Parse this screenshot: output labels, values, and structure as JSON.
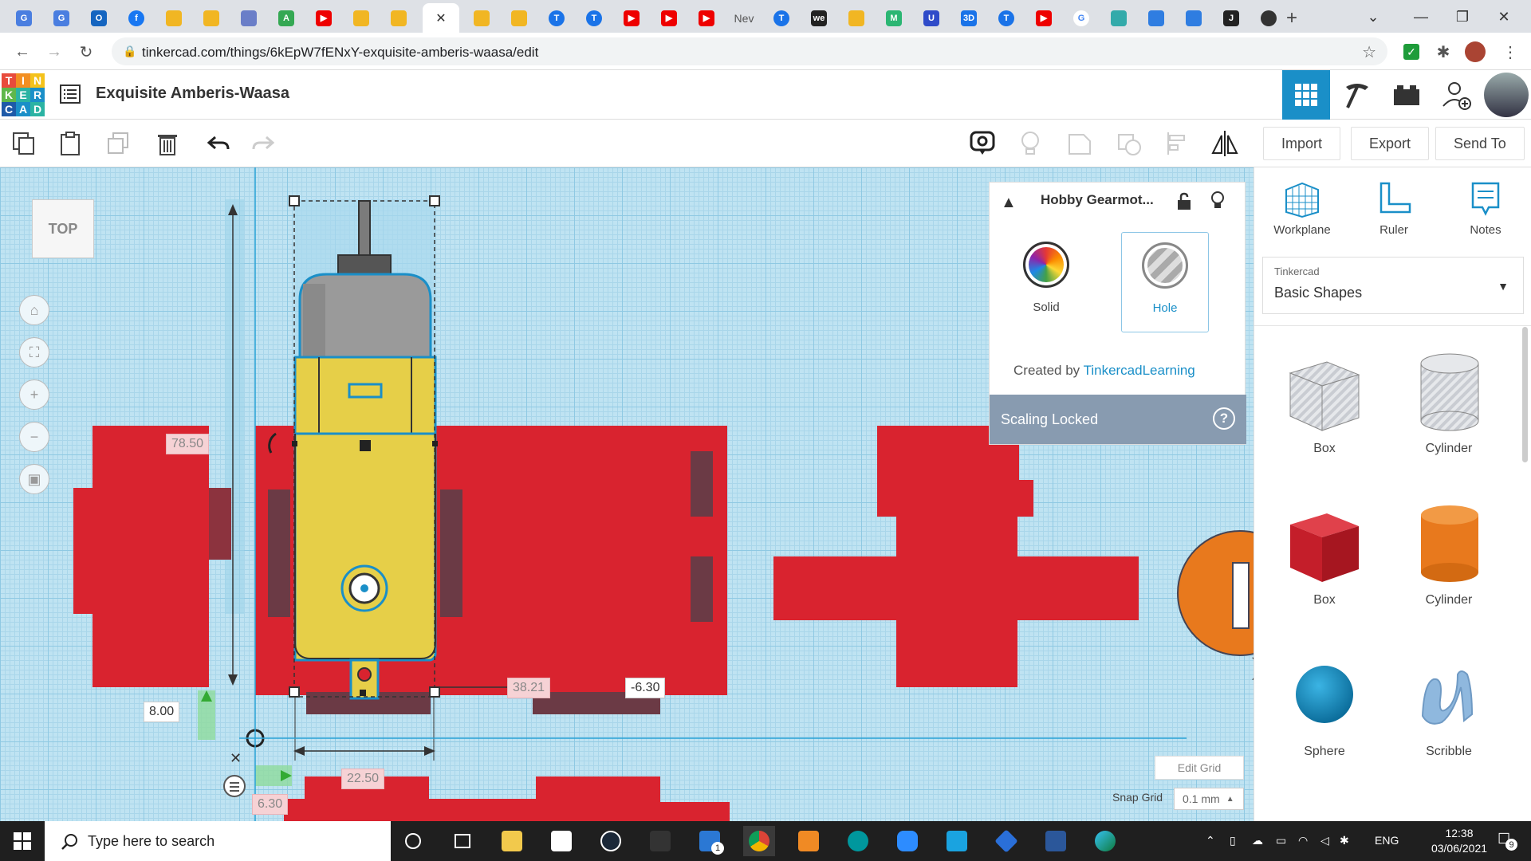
{
  "browser": {
    "url": "tinkercad.com/things/6kEpW7fENxY-exquisite-amberis-waasa/edit",
    "tab_text": "Nev",
    "new_tab_label": "+"
  },
  "app": {
    "logo_letters": [
      "T",
      "I",
      "N",
      "K",
      "E",
      "R",
      "C",
      "A",
      "D"
    ],
    "design_title": "Exquisite Amberis-Waasa"
  },
  "toolbar": {
    "import_label": "Import",
    "export_label": "Export",
    "send_to_label": "Send To"
  },
  "viewcube": {
    "label": "TOP"
  },
  "dimensions": {
    "length": "78.50",
    "x_pos": "38.21",
    "y_pos": "-6.30",
    "elevation": "8.00",
    "width": "22.50",
    "offset": "6.30"
  },
  "inspector": {
    "title": "Hobby Gearmot...",
    "solid_label": "Solid",
    "hole_label": "Hole",
    "created_by_prefix": "Created by ",
    "created_by_author": "TinkercadLearning",
    "scaling_locked": "Scaling Locked",
    "help": "?"
  },
  "right_panel": {
    "tools": [
      {
        "label": "Workplane",
        "icon": "workplane-icon"
      },
      {
        "label": "Ruler",
        "icon": "ruler-icon"
      },
      {
        "label": "Notes",
        "icon": "notes-icon"
      }
    ],
    "library_source": "Tinkercad",
    "library_name": "Basic Shapes",
    "shapes": [
      {
        "label": "Box",
        "style": "hole"
      },
      {
        "label": "Cylinder",
        "style": "hole"
      },
      {
        "label": "Box",
        "style": "solid",
        "color": "#d9232f"
      },
      {
        "label": "Cylinder",
        "style": "solid",
        "color": "#e8791d"
      },
      {
        "label": "Sphere",
        "style": "solid",
        "color": "#1a93c9"
      },
      {
        "label": "Scribble",
        "style": "solid",
        "color": "#7fb0d9"
      }
    ]
  },
  "grid": {
    "edit_grid": "Edit Grid",
    "snap_grid_label": "Snap Grid",
    "snap_grid_value": "0.1 mm"
  },
  "taskbar": {
    "search_placeholder": "Type here to search",
    "language": "ENG",
    "time": "12:38",
    "date": "03/06/2021",
    "mail_badge": "1",
    "notifications": "9"
  },
  "colors": {
    "accent": "#1a8fc8",
    "red_part": "#d9232f",
    "motor_yellow": "#e6cf48",
    "orange_part": "#e8791d",
    "grid_bg": "#bfe3f2"
  }
}
